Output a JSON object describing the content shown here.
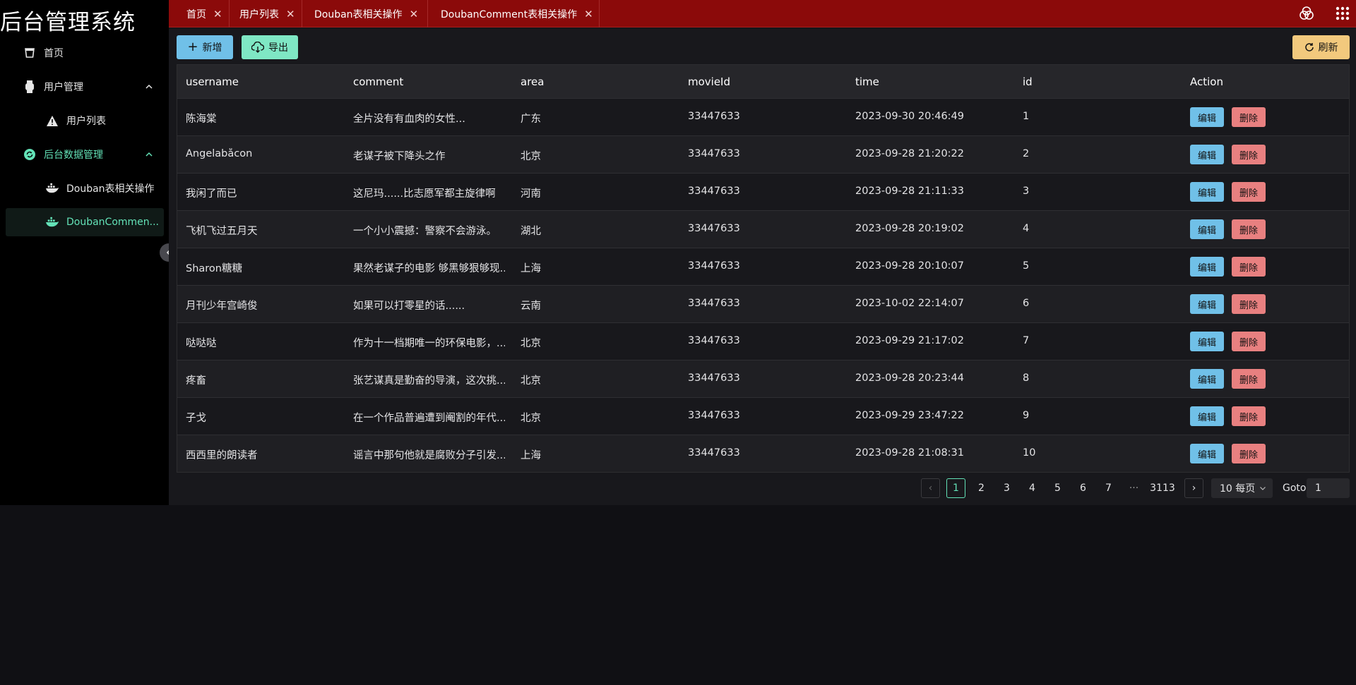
{
  "app": {
    "title": "后台管理系统"
  },
  "sidebar": {
    "items": [
      {
        "label": "首页",
        "icon": "home-cup-icon"
      },
      {
        "label": "用户管理",
        "icon": "watch-icon"
      },
      {
        "label": "用户列表",
        "icon": "warning-icon"
      },
      {
        "label": "后台数据管理",
        "icon": "refresh-circle-icon"
      },
      {
        "label": "Douban表相关操作",
        "icon": "docker-icon"
      },
      {
        "label": "DoubanCommen...",
        "icon": "docker-icon"
      }
    ]
  },
  "tabs": [
    {
      "label": "首页"
    },
    {
      "label": "用户列表"
    },
    {
      "label": "Douban表相关操作"
    },
    {
      "label": "DoubanComment表相关操作"
    }
  ],
  "toolbar": {
    "new_label": "新增",
    "export_label": "导出",
    "refresh_label": "刷新"
  },
  "table": {
    "columns": [
      "username",
      "comment",
      "area",
      "movieId",
      "time",
      "id",
      "Action"
    ],
    "edit_label": "编辑",
    "delete_label": "删除",
    "rows": [
      {
        "username": "陈海棠",
        "comment": "全片没有有血肉的女性...",
        "area": "广东",
        "movieId": "33447633",
        "time": "2023-09-30 20:46:49",
        "id": "1"
      },
      {
        "username": "Angelabåcon",
        "comment": "老谋子被下降头之作",
        "area": "北京",
        "movieId": "33447633",
        "time": "2023-09-28 21:20:22",
        "id": "2"
      },
      {
        "username": "我闲了而已",
        "comment": "这尼玛......比志愿军都主旋律啊",
        "area": "河南",
        "movieId": "33447633",
        "time": "2023-09-28 21:11:33",
        "id": "3"
      },
      {
        "username": "飞机飞过五月天",
        "comment": "一个小小震撼：警察不会游泳。",
        "area": "湖北",
        "movieId": "33447633",
        "time": "2023-09-28 20:19:02",
        "id": "4"
      },
      {
        "username": "Sharon糖糖",
        "comment": "果然老谋子的电影 够黑够狠够现...",
        "area": "上海",
        "movieId": "33447633",
        "time": "2023-09-28 20:10:07",
        "id": "5"
      },
      {
        "username": "月刊少年宫崎俊",
        "comment": "如果可以打零星的话......",
        "area": "云南",
        "movieId": "33447633",
        "time": "2023-10-02 22:14:07",
        "id": "6"
      },
      {
        "username": "哒哒哒",
        "comment": "作为十一档期唯一的环保电影，...",
        "area": "北京",
        "movieId": "33447633",
        "time": "2023-09-29 21:17:02",
        "id": "7"
      },
      {
        "username": "疼畜",
        "comment": "张艺谋真是勤奋的导演，这次挑...",
        "area": "北京",
        "movieId": "33447633",
        "time": "2023-09-28 20:23:44",
        "id": "8"
      },
      {
        "username": "子戈",
        "comment": "在一个作品普遍遭到阉割的年代...",
        "area": "北京",
        "movieId": "33447633",
        "time": "2023-09-29 23:47:22",
        "id": "9"
      },
      {
        "username": "西西里的朗读者",
        "comment": "谣言中那句他就是腐败分子引发...",
        "area": "上海",
        "movieId": "33447633",
        "time": "2023-09-28 21:08:31",
        "id": "10"
      }
    ]
  },
  "pagination": {
    "prev": "‹",
    "next": "›",
    "pages": [
      "1",
      "2",
      "3",
      "4",
      "5",
      "6",
      "7"
    ],
    "ellipsis": "···",
    "last": "3113",
    "current": "1",
    "page_size": "10 每页",
    "goto_label": "Goto",
    "goto_value": "1"
  }
}
